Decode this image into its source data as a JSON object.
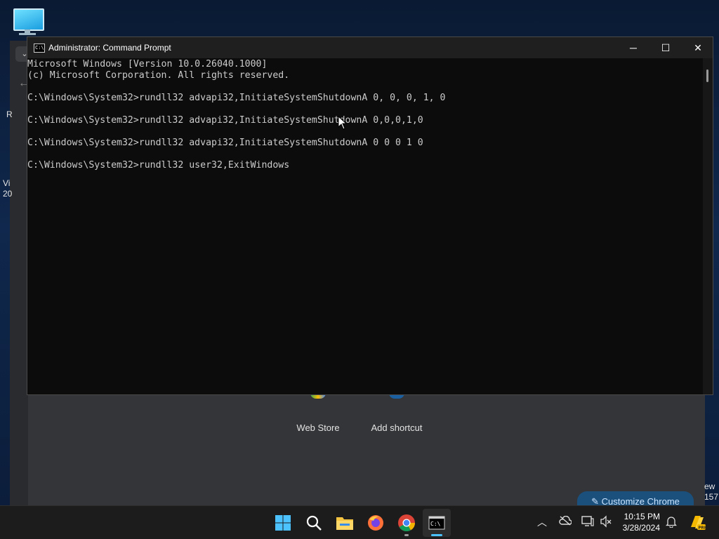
{
  "desktop": {
    "icon": "this-pc-icon"
  },
  "chrome": {
    "left_fragment_1": "R",
    "left_fragment_2a": "Vi",
    "left_fragment_2b": "20",
    "right_fragment_a": "ew",
    "right_fragment_b": "157",
    "shortcuts": [
      {
        "label": "Web Store",
        "icon": "web-store-icon"
      },
      {
        "label": "Add shortcut",
        "icon": "add-shortcut-icon"
      }
    ],
    "customize_label": "Customize Chrome",
    "accent": "#1b4f7c"
  },
  "cmd": {
    "title": "Administrator: Command Prompt",
    "icon_text": "C:\\",
    "lines": [
      "Microsoft Windows [Version 10.0.26040.1000]",
      "(c) Microsoft Corporation. All rights reserved.",
      "",
      "C:\\Windows\\System32>rundll32 advapi32,InitiateSystemShutdownA 0, 0, 0, 1, 0",
      "",
      "C:\\Windows\\System32>rundll32 advapi32,InitiateSystemShutdownA 0,0,0,1,0",
      "",
      "C:\\Windows\\System32>rundll32 advapi32,InitiateSystemShutdownA 0 0 0 1 0",
      "",
      "C:\\Windows\\System32>rundll32 user32,ExitWindows"
    ]
  },
  "taskbar": {
    "apps": [
      "start-icon",
      "search-icon",
      "file-explorer-icon",
      "firefox-icon",
      "chrome-icon",
      "command-prompt-icon"
    ],
    "time": "10:15 PM",
    "date": "3/28/2024",
    "tray_icons": [
      "chevron-up-icon",
      "onedrive-icon",
      "network-icon",
      "volume-icon",
      "notification-icon",
      "copilot-icon"
    ]
  }
}
